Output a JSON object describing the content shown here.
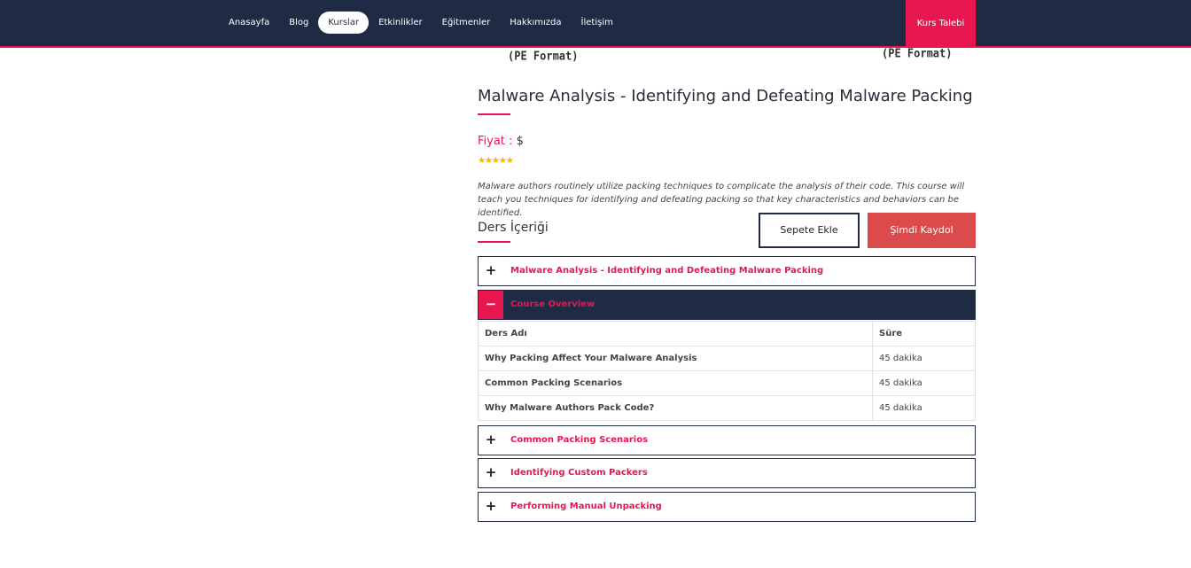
{
  "nav": {
    "items": [
      "Anasayfa",
      "Blog",
      "Kurslar",
      "Etkinlikler",
      "Eğitmenler",
      "Hakkımızda",
      "İletişim"
    ],
    "active_index": 2,
    "cta": "Kurs Talebi"
  },
  "image_captions": {
    "left": "(PE Format)",
    "right": "(PE Format)"
  },
  "course": {
    "title": "Malware Analysis - Identifying and Defeating Malware Packing",
    "price_label": "Fiyat :",
    "price_value": "$",
    "rating": "★★★★★",
    "description": "Malware authors routinely utilize packing techniques to complicate the analysis of their code. This course will teach you techniques for identifying and defeating packing so that key characteristics and behaviors can be identified."
  },
  "content_section": {
    "label": "Ders İçeriği"
  },
  "buttons": {
    "add_to_cart": "Sepete Ekle",
    "enroll": "Şimdi Kaydol"
  },
  "accordion": [
    {
      "sign": "+",
      "label": "Malware Analysis - Identifying and Defeating Malware Packing"
    },
    {
      "sign": "−",
      "label": "Course Overview"
    },
    {
      "sign": "+",
      "label": "Common Packing Scenarios"
    },
    {
      "sign": "+",
      "label": "Identifying Custom Packers"
    },
    {
      "sign": "+",
      "label": "Performing Manual Unpacking"
    }
  ],
  "lessons_table": {
    "headers": [
      "Ders Adı",
      "Süre"
    ],
    "rows": [
      [
        "Why Packing Affect Your Malware Analysis",
        "45 dakika"
      ],
      [
        "Common Packing Scenarios",
        "45 dakika"
      ],
      [
        "Why Malware Authors Pack Code?",
        "45 dakika"
      ]
    ]
  },
  "colors": {
    "navy": "#1f2a44",
    "accent": "#e8174f",
    "enroll": "#dc4b4b",
    "star": "#f5b301"
  }
}
